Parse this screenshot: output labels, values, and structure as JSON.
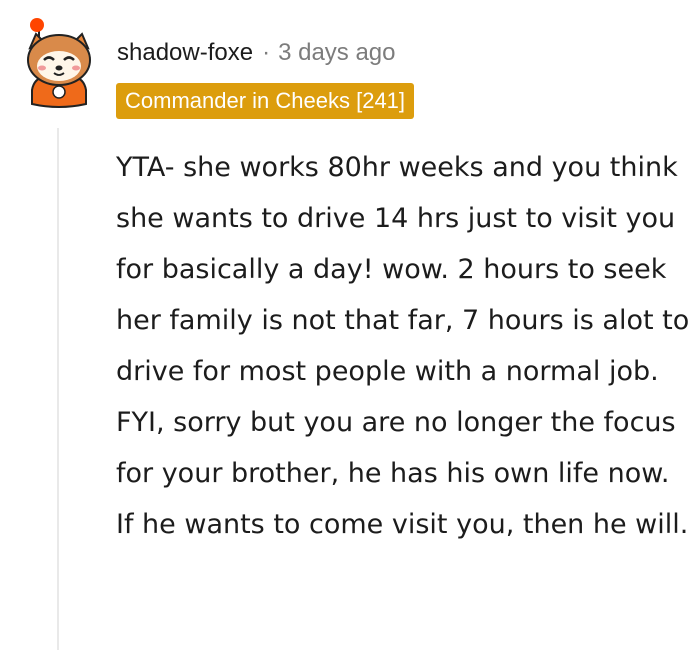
{
  "comment": {
    "author": "shadow-foxe",
    "separator": "·",
    "timestamp": "3 days ago",
    "flair": "Commander in Cheeks [241]",
    "flair_color": "#dc9d0d",
    "avatar_icon": "fox-avatar-icon",
    "body": "YTA- she works 80hr weeks and you think she wants to drive 14 hrs just to visit you for basically a day! wow. 2 hours to seek her family is not that far, 7 hours is alot to drive for most people with a normal job. FYI, sorry but you are no longer the focus for your brother, he has his own life now. If he wants to come visit you, then he will."
  }
}
